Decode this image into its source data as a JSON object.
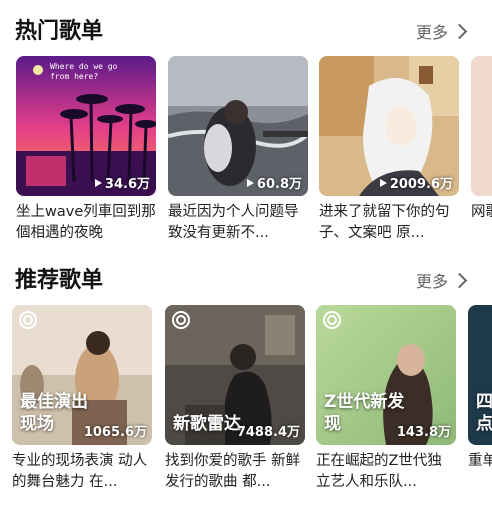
{
  "hot": {
    "title": "热门歌单",
    "more": "更多",
    "cards": [
      {
        "count": "34.6万",
        "caption": "坐上wave列車回到那個相遇的夜晚",
        "art_text": "Where do we go from here?"
      },
      {
        "count": "60.8万",
        "caption": "最近因为个人问题导致没有更新不..."
      },
      {
        "count": "2009.6万",
        "caption": "进来了就留下你的句子、文案吧 原..."
      },
      {
        "count": "",
        "caption": "网歌"
      }
    ]
  },
  "recommend": {
    "title": "推荐歌单",
    "more": "更多",
    "cards": [
      {
        "overlay": "最佳演出现场",
        "count": "1065.6万",
        "caption": "专业的现场表演 动人的舞台魅力 在..."
      },
      {
        "overlay": "新歌雷达",
        "count": "7488.4万",
        "caption": "找到你爱的歌手 新鲜发行的歌曲 都..."
      },
      {
        "overlay": "Z世代新发现",
        "count": "143.8万",
        "caption": "正在崛起的Z世代独立艺人和乐队..."
      },
      {
        "overlay": "四点",
        "count": "",
        "caption": "重单"
      }
    ]
  },
  "colors": {
    "accent": "#ffffff",
    "text": "#111111",
    "muted": "#666666"
  }
}
